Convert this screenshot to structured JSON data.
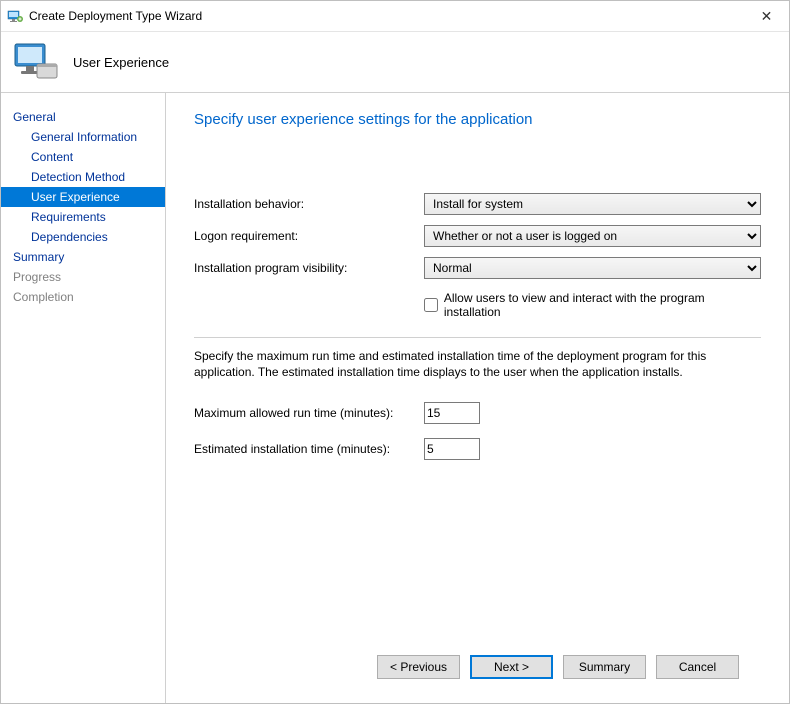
{
  "window": {
    "title": "Create Deployment Type Wizard",
    "close_glyph": "✕"
  },
  "header": {
    "title": "User Experience"
  },
  "sidebar": {
    "items": [
      {
        "label": "General",
        "child": false,
        "selected": false,
        "disabled": false
      },
      {
        "label": "General Information",
        "child": true,
        "selected": false,
        "disabled": false
      },
      {
        "label": "Content",
        "child": true,
        "selected": false,
        "disabled": false
      },
      {
        "label": "Detection Method",
        "child": true,
        "selected": false,
        "disabled": false
      },
      {
        "label": "User Experience",
        "child": true,
        "selected": true,
        "disabled": false
      },
      {
        "label": "Requirements",
        "child": true,
        "selected": false,
        "disabled": false
      },
      {
        "label": "Dependencies",
        "child": true,
        "selected": false,
        "disabled": false
      },
      {
        "label": "Summary",
        "child": false,
        "selected": false,
        "disabled": false
      },
      {
        "label": "Progress",
        "child": false,
        "selected": false,
        "disabled": true
      },
      {
        "label": "Completion",
        "child": false,
        "selected": false,
        "disabled": true
      }
    ]
  },
  "page": {
    "heading": "Specify user experience settings for the application",
    "installation_behavior": {
      "label": "Installation behavior:",
      "value": "Install for system"
    },
    "logon_requirement": {
      "label": "Logon requirement:",
      "value": "Whether or not a user is logged on"
    },
    "program_visibility": {
      "label": "Installation program visibility:",
      "value": "Normal"
    },
    "allow_interact": {
      "checked": false,
      "label": "Allow users to view and interact with the program installation"
    },
    "runtime_text": "Specify the maximum run time and estimated installation time of the deployment program for this application. The estimated installation time displays to the user when the application installs.",
    "max_runtime": {
      "label": "Maximum allowed run time (minutes):",
      "value": "15"
    },
    "est_time": {
      "label": "Estimated installation time (minutes):",
      "value": "5"
    }
  },
  "footer": {
    "previous": "< Previous",
    "next": "Next >",
    "summary": "Summary",
    "cancel": "Cancel"
  }
}
